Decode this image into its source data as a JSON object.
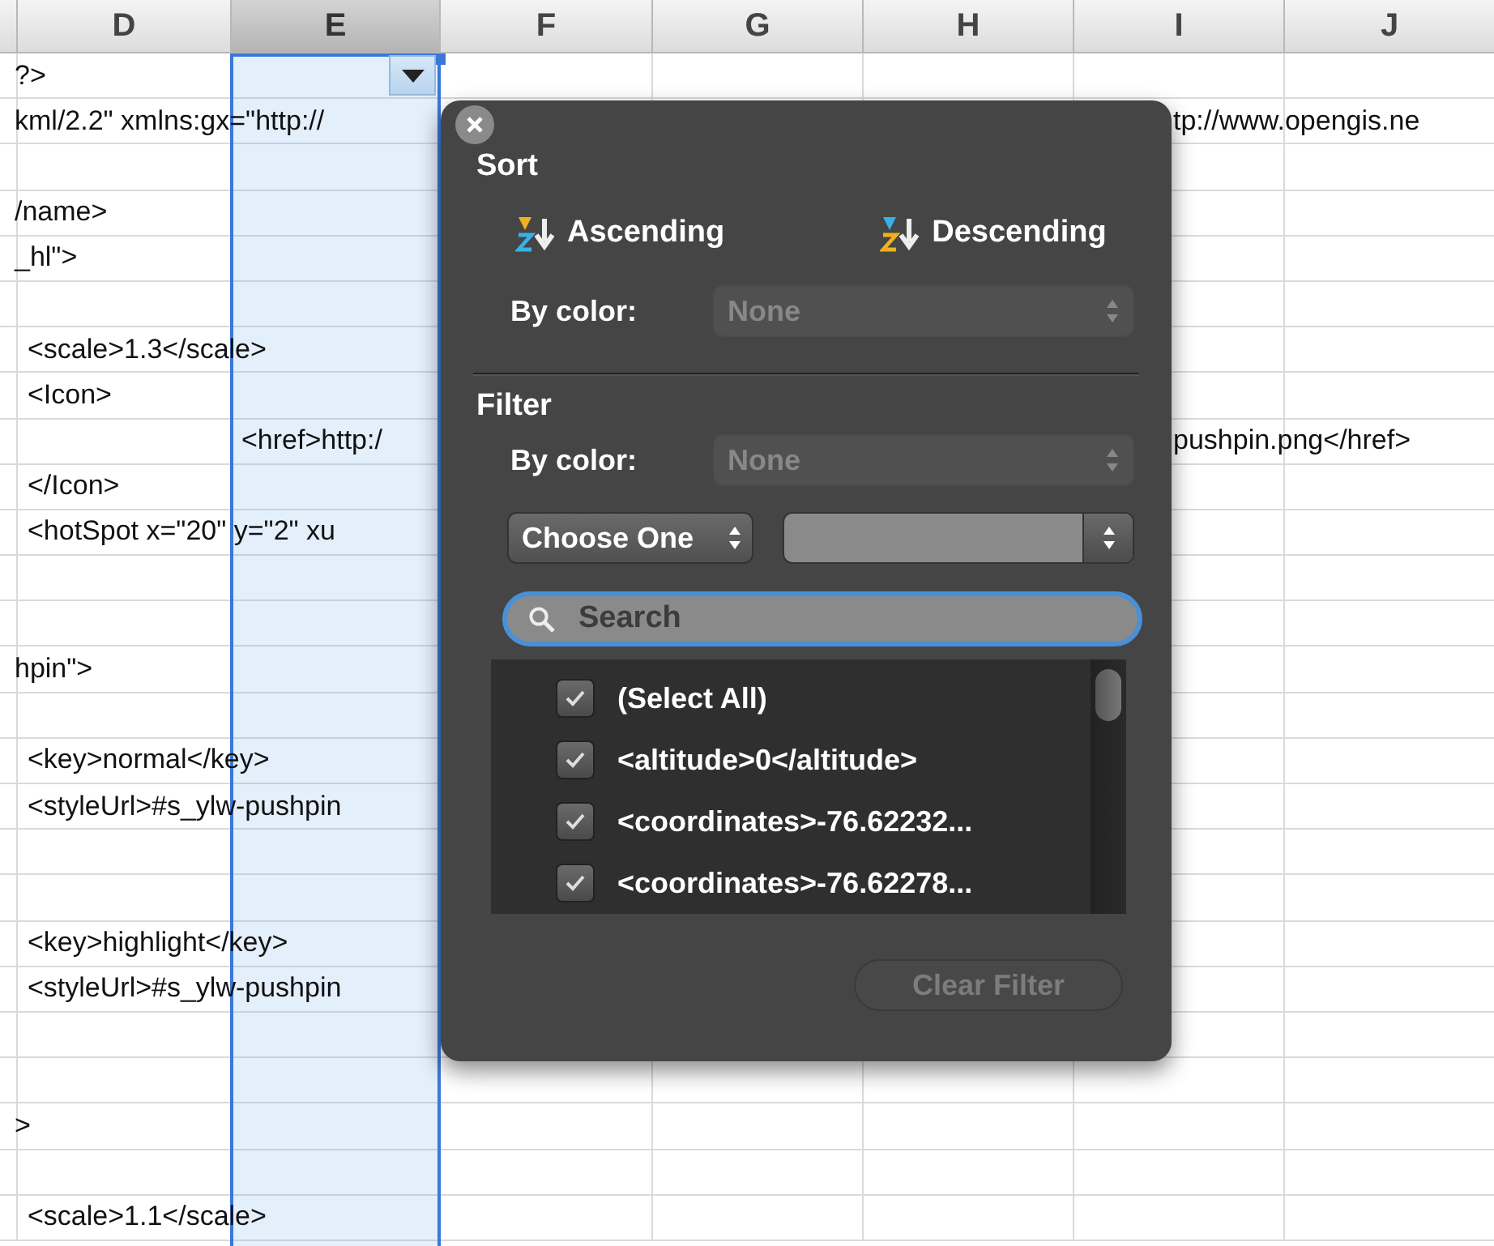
{
  "sheet": {
    "columns": [
      {
        "label": "D",
        "selected": false
      },
      {
        "label": "E",
        "selected": true
      },
      {
        "label": "F",
        "selected": false
      },
      {
        "label": "G",
        "selected": false
      },
      {
        "label": "H",
        "selected": false
      },
      {
        "label": "I",
        "selected": false
      },
      {
        "label": "J",
        "selected": false
      }
    ],
    "rows": [
      {
        "cells": [
          {
            "kind": "text",
            "text": "?>"
          }
        ]
      },
      {
        "cells": [
          {
            "kind": "text",
            "text": "kml/2.2\" xmlns:gx=\"http://"
          },
          {
            "kind": "continuation",
            "text": "tp://www.opengis.ne"
          }
        ]
      },
      {},
      {
        "cells": [
          {
            "kind": "text",
            "text": "/name>"
          }
        ]
      },
      {
        "cells": [
          {
            "kind": "text",
            "text": "_hl\">"
          }
        ]
      },
      {},
      {
        "cells": [
          {
            "kind": "indented",
            "text": "<scale>1.3</scale>"
          }
        ]
      },
      {
        "cells": [
          {
            "kind": "indented",
            "text": "<Icon>"
          }
        ]
      },
      {
        "cells": [
          {
            "kind": "nested",
            "text": "<href>http:/"
          },
          {
            "kind": "continuation",
            "text": "pushpin.png</href>"
          }
        ]
      },
      {
        "cells": [
          {
            "kind": "indented",
            "text": "</Icon>"
          }
        ]
      },
      {
        "cells": [
          {
            "kind": "indented",
            "text": "<hotSpot x=\"20\" y=\"2\" xu"
          }
        ]
      },
      {},
      {},
      {
        "cells": [
          {
            "kind": "text",
            "text": "hpin\">"
          }
        ]
      },
      {},
      {
        "cells": [
          {
            "kind": "indented",
            "text": "<key>normal</key>"
          }
        ]
      },
      {
        "cells": [
          {
            "kind": "indented",
            "text": "<styleUrl>#s_ylw-pushpin"
          }
        ]
      },
      {},
      {},
      {
        "cells": [
          {
            "kind": "indented",
            "text": "<key>highlight</key>"
          }
        ]
      },
      {
        "cells": [
          {
            "kind": "indented",
            "text": "<styleUrl>#s_ylw-pushpin"
          }
        ]
      },
      {},
      {},
      {
        "cells": [
          {
            "kind": "text",
            "text": ">"
          }
        ]
      },
      {},
      {
        "cells": [
          {
            "kind": "indented",
            "text": "<scale>1.1</scale>"
          }
        ]
      }
    ]
  },
  "filter_popup": {
    "sort": {
      "title": "Sort",
      "ascending": "Ascending",
      "descending": "Descending",
      "by_color_label": "By color:",
      "by_color_value": "None",
      "by_color_disabled": true
    },
    "filter": {
      "title": "Filter",
      "by_color_label": "By color:",
      "by_color_value": "None",
      "by_color_disabled": true,
      "condition": "Choose One",
      "search_placeholder": "Search",
      "items": [
        {
          "label": "(Select All)",
          "checked": true
        },
        {
          "label": "<altitude>0</altitude>",
          "checked": true
        },
        {
          "label": "<coordinates>-76.62232...",
          "checked": true
        },
        {
          "label": "<coordinates>-76.62278...",
          "checked": true
        }
      ],
      "clear_button": {
        "label": "Clear Filter",
        "disabled": true
      }
    }
  }
}
